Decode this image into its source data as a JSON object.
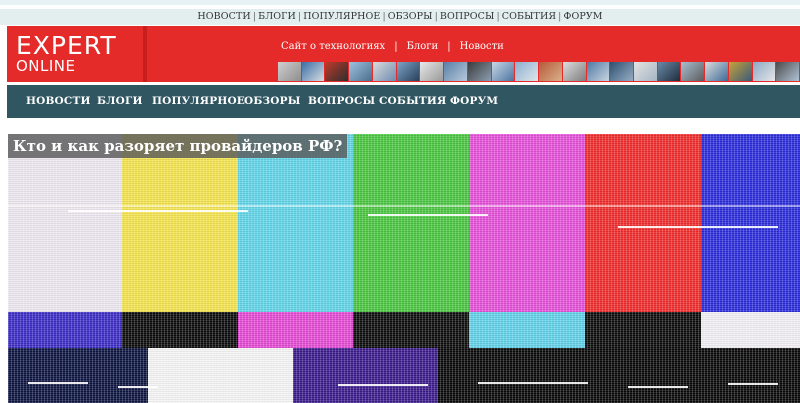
{
  "top_nav": {
    "items": [
      "НОВОСТИ",
      "БЛОГИ",
      "ПОПУЛЯРНОЕ",
      "ОБЗОРЫ",
      "ВОПРОСЫ",
      "СОБЫТИЯ",
      "ФОРУМ"
    ],
    "separator": "|"
  },
  "logo": {
    "line1": "EXPERT",
    "line2": "ONLINE"
  },
  "header_links": {
    "items": [
      "Сайт о технологиях",
      "Блоги",
      "Новости"
    ],
    "separator": "|"
  },
  "main_nav": {
    "items": [
      "НОВОСТИ",
      "БЛОГИ",
      "ПОПУЛЯРНОЕ",
      "ОБЗОРЫ",
      "ВОПРОСЫ",
      "СОБЫТИЯ",
      "ФОРУМ"
    ]
  },
  "article": {
    "title": "Кто и как разоряет провайдеров РФ?"
  },
  "colors": {
    "brand_red": "#e52a2a",
    "nav_bg": "#2f5661",
    "topbar_bg": "#e3efef"
  }
}
